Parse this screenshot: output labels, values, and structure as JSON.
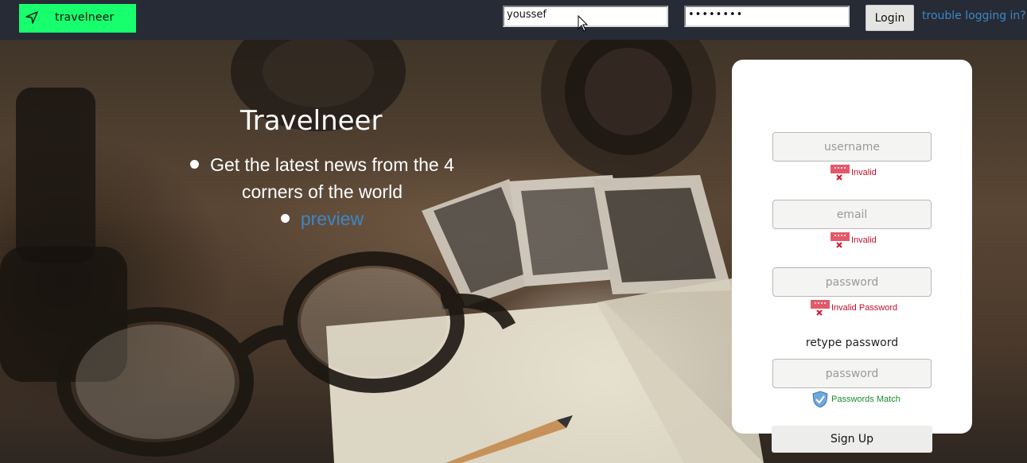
{
  "navbar": {
    "brand_label": "travelneer",
    "brand_icon": "navigation-arrow-icon",
    "brand_color": "#18ff6d",
    "username_value": "youssef",
    "password_value": "••••••••",
    "login_label": "Login",
    "trouble_link": "trouble logging in?",
    "link_color": "#3e86c6"
  },
  "hero": {
    "title": "Travelneer",
    "features": [
      {
        "text": "Get the latest news from the 4 corners of the world"
      },
      {
        "text": "preview",
        "is_link": true
      }
    ]
  },
  "signup": {
    "username_placeholder": "username",
    "username_msg": "Invalid",
    "email_placeholder": "email",
    "email_msg": "Invalid",
    "password_placeholder": "password",
    "password_msg": "Invalid Password",
    "retype_label": "retype password",
    "retype_placeholder": "password",
    "retype_msg": "Passwords Match",
    "signup_label": "Sign Up",
    "error_color": "#c0102a",
    "success_color": "#1a8a2c"
  }
}
